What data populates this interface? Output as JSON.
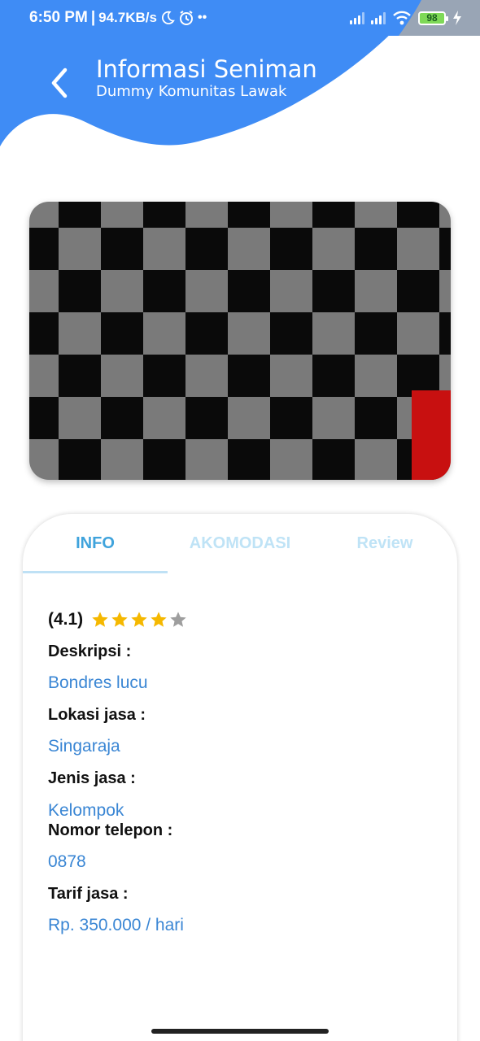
{
  "status_bar": {
    "time": "6:50 PM",
    "network_speed": "94.7KB/s",
    "battery_level": "98",
    "icons": [
      "moon-icon",
      "alarm-icon",
      "signal-icon",
      "signal-icon",
      "wifi-icon",
      "battery-icon",
      "charging-icon"
    ]
  },
  "header": {
    "title": "Informasi Seniman",
    "subtitle": "Dummy Komunitas Lawak",
    "color": "#3f8cf5"
  },
  "tabs": [
    {
      "label": "INFO",
      "active": true
    },
    {
      "label": "AKOMODASI",
      "active": false
    },
    {
      "label": "Review",
      "active": false
    }
  ],
  "info": {
    "rating": "(4.1)",
    "stars_filled": 4,
    "stars_total": 5,
    "fields": [
      {
        "label": "Deskripsi :",
        "value": "Bondres lucu"
      },
      {
        "label": "Lokasi jasa :",
        "value": "Singaraja"
      },
      {
        "label": "Jenis jasa :",
        "value": "Kelompok"
      },
      {
        "label": "Nomor telepon :",
        "value": "0878"
      },
      {
        "label": "Tarif jasa :",
        "value": "Rp. 350.000 / hari"
      }
    ]
  },
  "colors": {
    "accent": "#3f8cf5",
    "tab_active": "#3fa3dc",
    "tab_inactive": "#bfe3f6",
    "value_text": "#3a86d4",
    "star_filled": "#f5b800",
    "star_empty": "#9e9e9e"
  }
}
